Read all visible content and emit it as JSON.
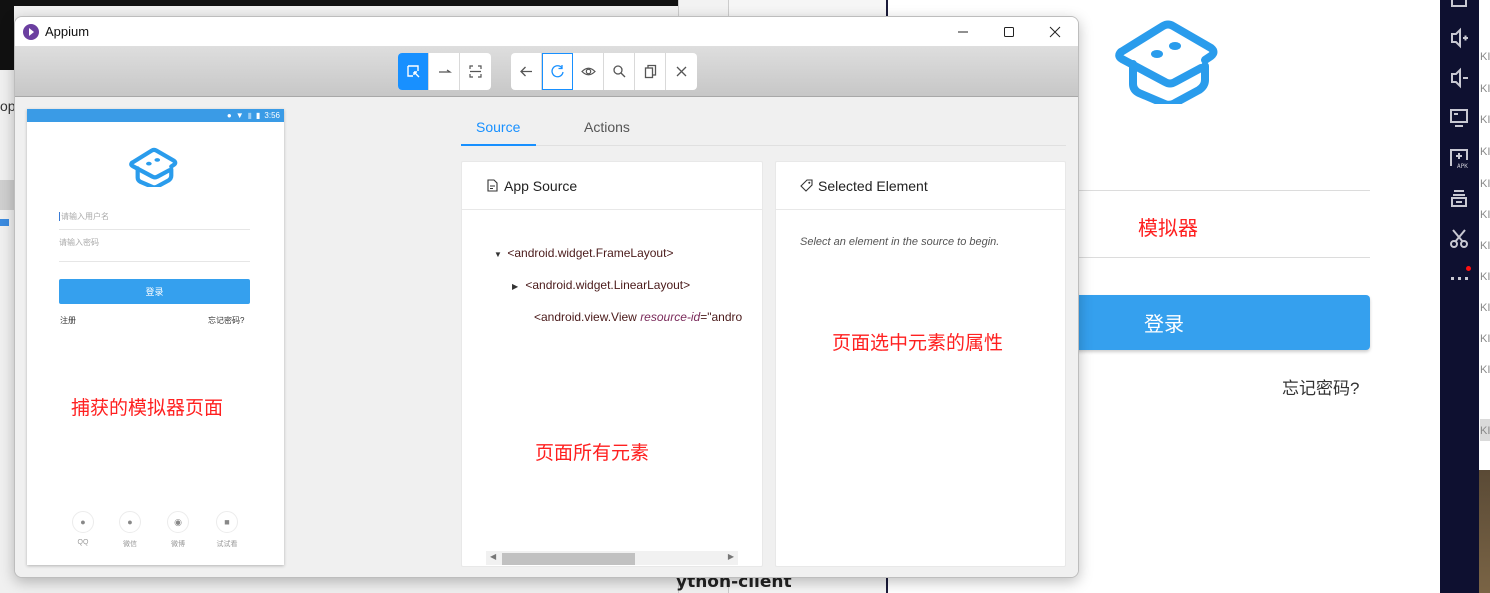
{
  "window": {
    "title": "Appium",
    "controls": {
      "minimize": "minimize",
      "maximize": "maximize",
      "close": "close"
    }
  },
  "toolbar": {
    "group1": [
      {
        "name": "select-elements",
        "icon": "select-cursor-icon",
        "active": true
      },
      {
        "name": "swipe",
        "icon": "swipe-arrow-icon"
      },
      {
        "name": "tap-by-coordinates",
        "icon": "crop-frame-icon"
      }
    ],
    "group2": [
      {
        "name": "back",
        "icon": "arrow-left-icon"
      },
      {
        "name": "refresh",
        "icon": "refresh-icon",
        "focused": true
      },
      {
        "name": "toggle-attributes",
        "icon": "eye-icon"
      },
      {
        "name": "search",
        "icon": "search-icon"
      },
      {
        "name": "copy-xml",
        "icon": "copy-icon"
      },
      {
        "name": "quit-session",
        "icon": "close-icon"
      }
    ]
  },
  "device": {
    "status_time": "3:56",
    "username_placeholder": "请输入用户名",
    "password_placeholder": "请输入密码",
    "login_label": "登录",
    "register_link": "注册",
    "forgot_link": "忘记密码?",
    "annotation": "捕获的模拟器页面",
    "social": [
      {
        "label": "QQ",
        "icon": "qq-icon"
      },
      {
        "label": "微信",
        "icon": "wechat-icon"
      },
      {
        "label": "微博",
        "icon": "weibo-icon"
      },
      {
        "label": "试试看",
        "icon": "ghost-icon"
      }
    ]
  },
  "tabs": [
    {
      "label": "Source",
      "active": true
    },
    {
      "label": "Actions",
      "active": false
    }
  ],
  "source_panel": {
    "title": "App Source",
    "nodes": [
      {
        "tag": "<android.widget.FrameLayout>",
        "expanded": true,
        "depth": 0
      },
      {
        "tag": "<android.widget.LinearLayout>",
        "expanded": false,
        "depth": 1
      },
      {
        "tag_open": "<android.view.View ",
        "attr_name": "resource-id",
        "attr_value": "=\"andro",
        "depth": 1
      }
    ],
    "annotation": "页面所有元素"
  },
  "selected_panel": {
    "title": "Selected Element",
    "hint": "Select an element in the source to begin.",
    "annotation": "页面选中元素的属性"
  },
  "emulator": {
    "annotation": "模拟器",
    "login_label": "登录",
    "forgot_link": "忘记密码?",
    "side_toolbar": [
      "window-icon",
      "volume-up-icon",
      "volume-down-icon",
      "screen-icon",
      "install-apk-icon",
      "multi-window-icon",
      "scissors-icon",
      "more-icon"
    ],
    "list_labels": [
      "KI",
      "KI",
      "KI",
      "KI",
      "KI",
      "KI",
      "KI",
      "KI",
      "KI",
      "KI",
      "KI",
      "KI"
    ]
  },
  "background": {
    "partial_text_left": "op",
    "partial_text_bottom": "ython-client"
  },
  "colors": {
    "accent": "#1890ff",
    "annotation_red": "#ff2020",
    "app_blue": "#35a0ee",
    "appium_purple": "#6b3fa0",
    "emulator_sidebar": "#0e1030"
  }
}
